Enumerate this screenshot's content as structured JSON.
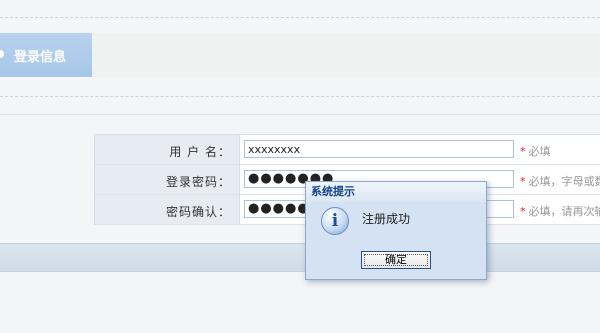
{
  "section": {
    "title": "登录信息"
  },
  "form": {
    "rows": [
      {
        "label": "用 户 名：",
        "value": "xxxxxxxx",
        "hint_star": "*",
        "hint": "必填"
      },
      {
        "label": "登录密码：",
        "value": "●●●●●●●",
        "hint_star": "*",
        "hint": "必填，字母或数"
      },
      {
        "label": "密码确认：",
        "value": "●●●●●●●",
        "hint_star": "*",
        "hint": "必填，请再次输"
      }
    ]
  },
  "dialog": {
    "title": "系统提示",
    "icon": "info-icon",
    "message": "注册成功",
    "ok_label": "确定"
  },
  "colors": {
    "accent": "#a7c6e8",
    "dialog_title": "#15428b",
    "required_star": "#e02020"
  }
}
